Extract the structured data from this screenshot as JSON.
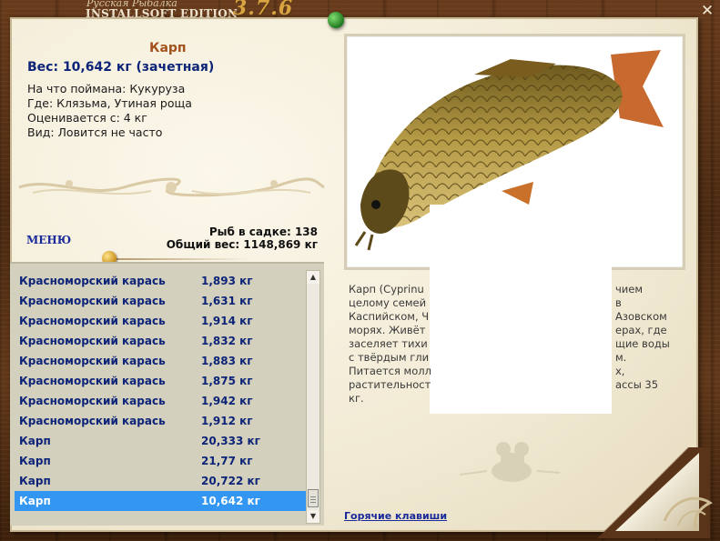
{
  "header": {
    "subtitle": "Русская Рыбалка",
    "title": "INSTALLSOFT EDITION",
    "version": "3.7.6",
    "close_label": "✕"
  },
  "fish": {
    "name": "Карп",
    "weight_line": "Вес: 10,642 кг (зачетная)",
    "details": [
      "На что поймана: Кукуруза",
      "Где: Клязьма, Утиная роща",
      "Оценивается с: 4 кг",
      "Вид: Ловится не часто"
    ]
  },
  "menu_label": "МЕНЮ",
  "stats": {
    "count": "Рыб в садке: 138",
    "total": "Общий вес: 1148,869 кг"
  },
  "catch_list": [
    {
      "name": "Красноморский карась",
      "weight": "1,893 кг"
    },
    {
      "name": "Красноморский карась",
      "weight": "1,631 кг"
    },
    {
      "name": "Красноморский карась",
      "weight": "1,914 кг"
    },
    {
      "name": "Красноморский карась",
      "weight": "1,832 кг"
    },
    {
      "name": "Красноморский карась",
      "weight": "1,883 кг"
    },
    {
      "name": "Красноморский карась",
      "weight": "1,875 кг"
    },
    {
      "name": "Красноморский карась",
      "weight": "1,942 кг"
    },
    {
      "name": "Красноморский карась",
      "weight": "1,912 кг"
    },
    {
      "name": "Карп",
      "weight": "20,333 кг"
    },
    {
      "name": "Карп",
      "weight": "21,77 кг"
    },
    {
      "name": "Карп",
      "weight": "20,722 кг"
    },
    {
      "name": "Карп",
      "weight": "10,642 кг",
      "selected": true
    }
  ],
  "description": {
    "left": [
      "Карп (Cyprinu",
      "целому семей",
      "Каспийском, Ч",
      "морях. Живёт",
      "заселяет тихи",
      "с твёрдым гли",
      "Питается молл",
      "растительност",
      "кг."
    ],
    "right": [
      "чием",
      "в",
      "Азовском",
      "ерах, где",
      "щие воды",
      "м.",
      "х,",
      "ассы 35"
    ]
  },
  "hotkeys_label": "Горячие клавиши",
  "colors": {
    "accent_name": "#a4521c",
    "link_blue": "#0d2478",
    "selection": "#3296f2"
  }
}
